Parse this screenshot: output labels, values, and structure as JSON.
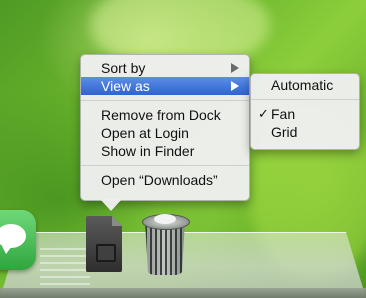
{
  "context_menu": {
    "items": [
      {
        "label": "Sort by"
      },
      {
        "label": "View as"
      },
      {
        "label": "Remove from Dock"
      },
      {
        "label": "Open at Login"
      },
      {
        "label": "Show in Finder"
      },
      {
        "label": "Open “Downloads”"
      }
    ],
    "highlight_color": "#3b6fd8"
  },
  "view_as_submenu": {
    "items": [
      {
        "label": "Automatic"
      },
      {
        "label": "Fan",
        "checked": true,
        "check_glyph": "✓"
      },
      {
        "label": "Grid"
      }
    ]
  },
  "dock": {
    "icons": [
      "messages-icon",
      "downloads-stack-icon",
      "trash-icon"
    ]
  },
  "desktop": {
    "background_color": "#6fb82e"
  }
}
